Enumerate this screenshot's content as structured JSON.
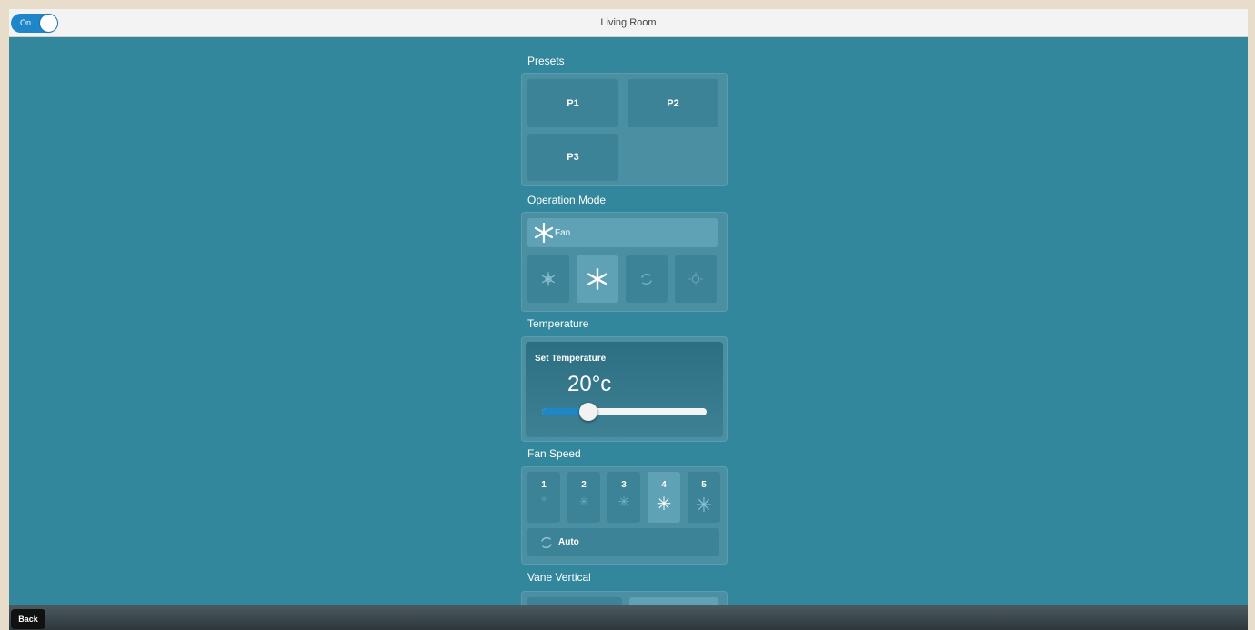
{
  "header": {
    "title": "Living Room",
    "power_label": "On"
  },
  "presets": {
    "label": "Presets",
    "items": [
      "P1",
      "P2",
      "P3"
    ]
  },
  "operation_mode": {
    "label": "Operation Mode",
    "current": "Fan",
    "icons": [
      "snowflake-icon",
      "fan-icon",
      "auto-cycle-icon",
      "sun-icon"
    ],
    "selected_index": 1
  },
  "temperature": {
    "label": "Temperature",
    "card_label": "Set Temperature",
    "value": "20°c",
    "slider_fraction": 0.28
  },
  "fan_speed": {
    "label": "Fan Speed",
    "levels": [
      "1",
      "2",
      "3",
      "4",
      "5"
    ],
    "selected_index": 3,
    "auto_label": "Auto"
  },
  "vane_vertical": {
    "label": "Vane Vertical"
  },
  "footer": {
    "back_label": "Back"
  },
  "colors": {
    "background": "#33879c",
    "accent": "#1f86c8",
    "panel": "#4a8fa2"
  }
}
